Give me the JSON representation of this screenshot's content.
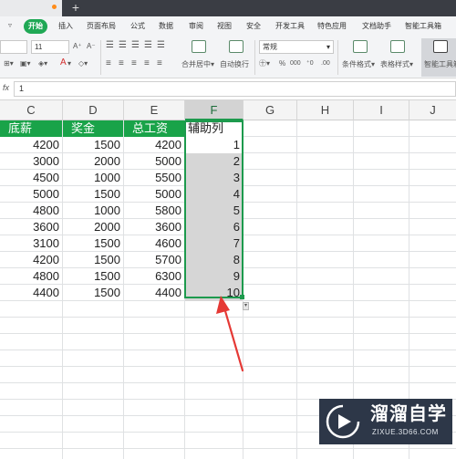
{
  "menubar": {
    "items": [
      {
        "label": "开始",
        "active": true
      },
      {
        "label": "插入"
      },
      {
        "label": "页面布局"
      },
      {
        "label": "公式"
      },
      {
        "label": "数据"
      },
      {
        "label": "审阅"
      },
      {
        "label": "视图"
      },
      {
        "label": "安全"
      },
      {
        "label": "开发工具"
      },
      {
        "label": "特色应用"
      },
      {
        "label": "文档助手"
      },
      {
        "label": "智能工具箱"
      }
    ]
  },
  "ribbon": {
    "font_size": "11",
    "number_format": "常规",
    "merge_center": "合并居中",
    "wrap_text": "自动换行",
    "percent": "%",
    "thousands": "000",
    "conditional_format": "条件格式",
    "table_style": "表格样式",
    "smart_toolbox": "智能工具箱",
    "font_color_letter": "A"
  },
  "formula_bar": {
    "fx_label": "fx",
    "value": "1"
  },
  "columns": [
    "C",
    "D",
    "E",
    "F",
    "G",
    "H",
    "I",
    "J"
  ],
  "table": {
    "headers": [
      "底薪",
      "奖金",
      "总工资",
      "辅助列"
    ],
    "rows": [
      [
        "4200",
        "1500",
        "4200",
        "1"
      ],
      [
        "3000",
        "2000",
        "5000",
        "2"
      ],
      [
        "4500",
        "1000",
        "5500",
        "3"
      ],
      [
        "5000",
        "1500",
        "5000",
        "4"
      ],
      [
        "4800",
        "1000",
        "5800",
        "5"
      ],
      [
        "3600",
        "2000",
        "3600",
        "6"
      ],
      [
        "3100",
        "1500",
        "4600",
        "7"
      ],
      [
        "4200",
        "1500",
        "5700",
        "8"
      ],
      [
        "4800",
        "1500",
        "6300",
        "9"
      ],
      [
        "4400",
        "1500",
        "4400",
        "10"
      ]
    ]
  },
  "annotation": {
    "color": "#e53935"
  },
  "watermark": {
    "title": "溜溜自学",
    "url": "ZIXUE.3D66.COM"
  },
  "colors": {
    "accent_green": "#1fa855",
    "header_green": "#19a349",
    "arrow_red": "#e53935"
  }
}
